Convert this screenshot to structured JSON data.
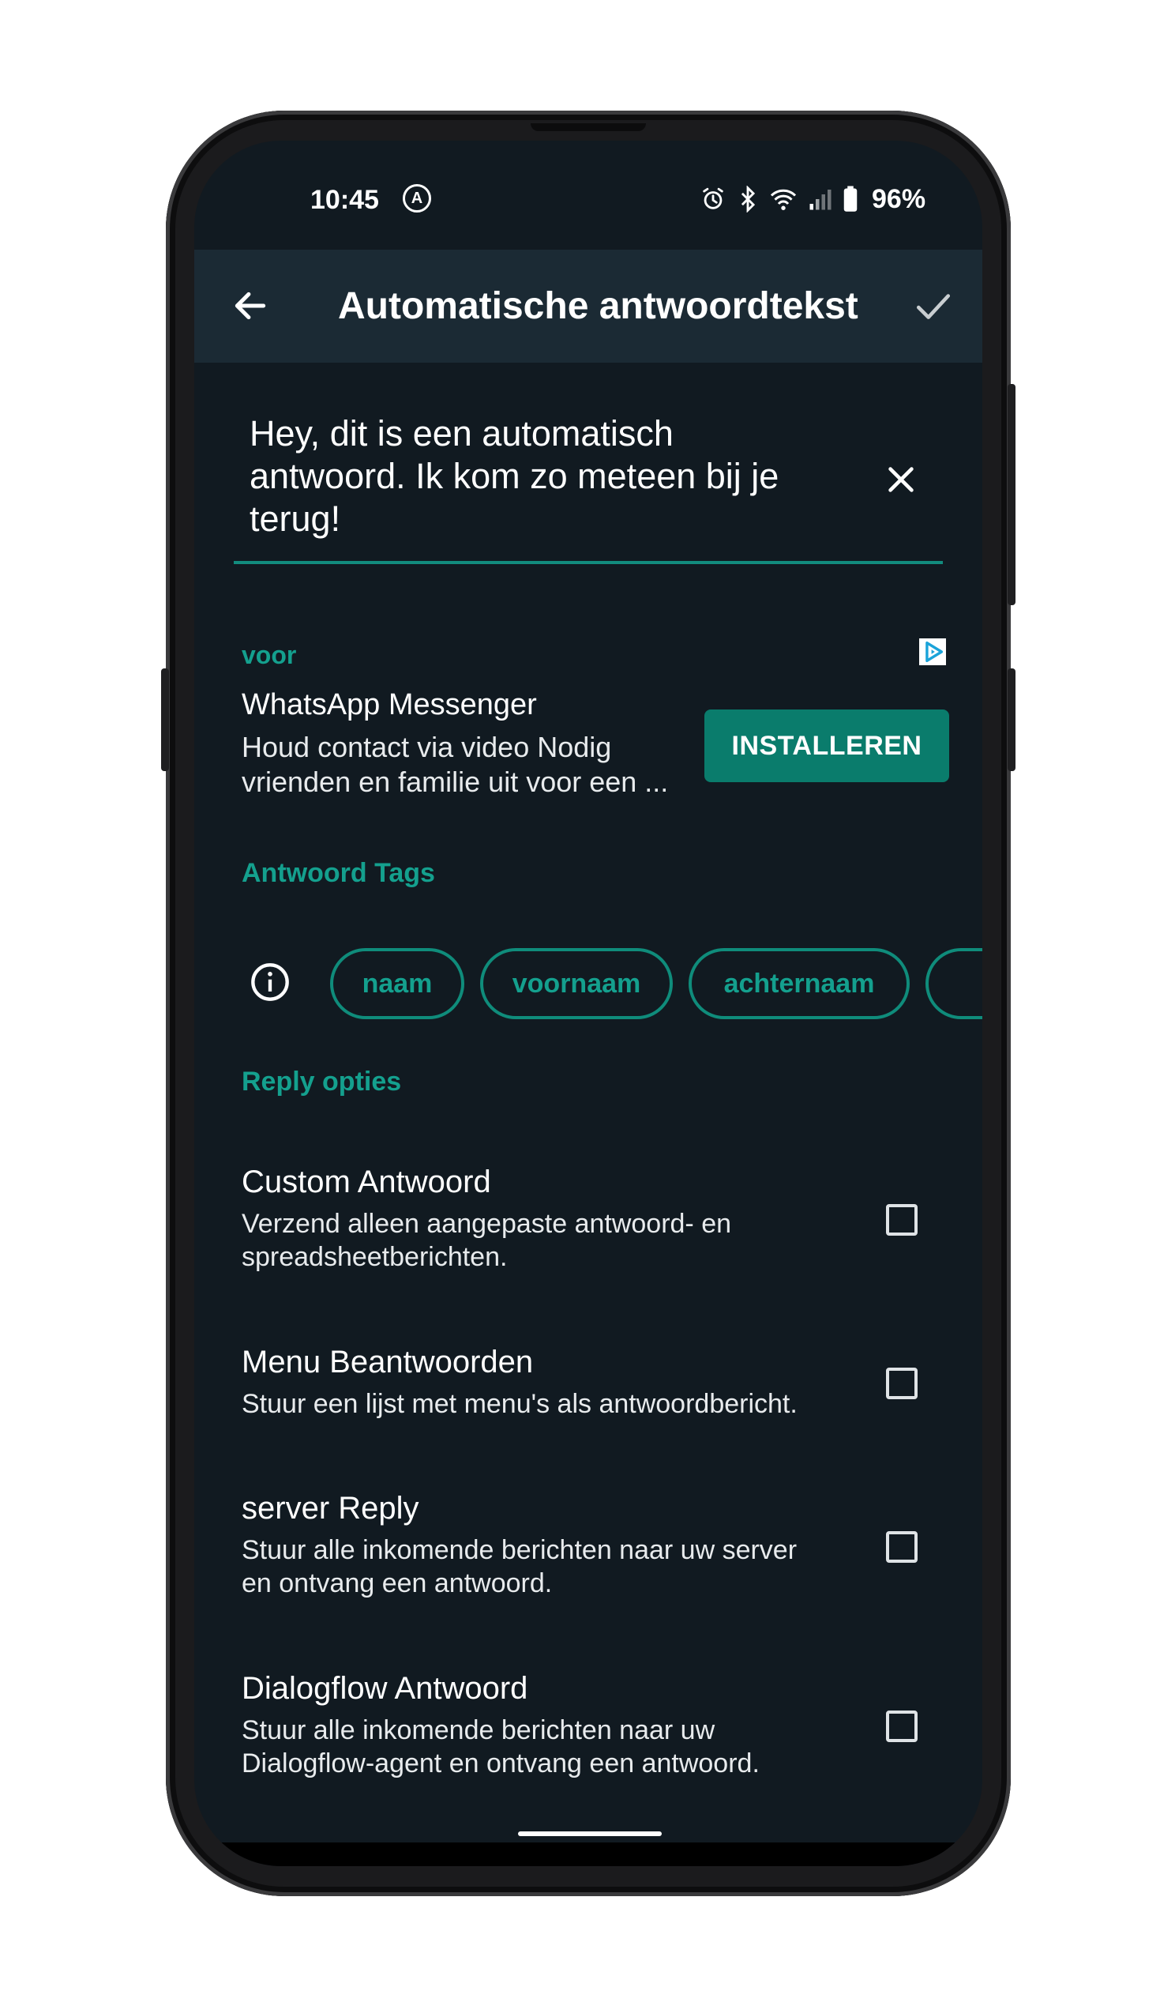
{
  "status_bar": {
    "time": "10:45",
    "a_badge": "A",
    "battery": "96%"
  },
  "app_bar": {
    "title": "Automatische antwoordtekst",
    "icons": [
      "arrow-back-icon",
      "check-icon"
    ]
  },
  "reply_text": {
    "value": "Hey, dit is een automatisch\nantwoord. Ik kom zo meteen bij je\nterug!"
  },
  "ad": {
    "label": "voor",
    "title": "WhatsApp Messenger",
    "description": "Houd contact via video Nodig\nvrienden en familie uit voor een ...",
    "button": "INSTALLEREN"
  },
  "tags_section": {
    "label": "Antwoord Tags",
    "tags": [
      "naam",
      "voornaam",
      "achternaam"
    ]
  },
  "reply_options": {
    "label": "Reply opties",
    "items": [
      {
        "title": "Custom Antwoord",
        "description": "Verzend alleen aangepaste antwoord- en\nspreadsheetberichten.",
        "checked": false
      },
      {
        "title": "Menu Beantwoorden",
        "description": "Stuur een lijst met menu's als antwoordbericht.",
        "checked": false
      },
      {
        "title": "server Reply",
        "description": "Stuur alle inkomende berichten naar uw server\nen ontvang een antwoord.",
        "checked": false
      },
      {
        "title": "Dialogflow Antwoord",
        "description": "Stuur alle inkomende berichten naar uw\nDialogflow-agent en ontvang een antwoord.",
        "checked": false
      }
    ]
  },
  "colors": {
    "accent": "#14a08e",
    "button": "#0a7c6c",
    "background": "#111a21",
    "app_bar": "#1b2a34"
  }
}
